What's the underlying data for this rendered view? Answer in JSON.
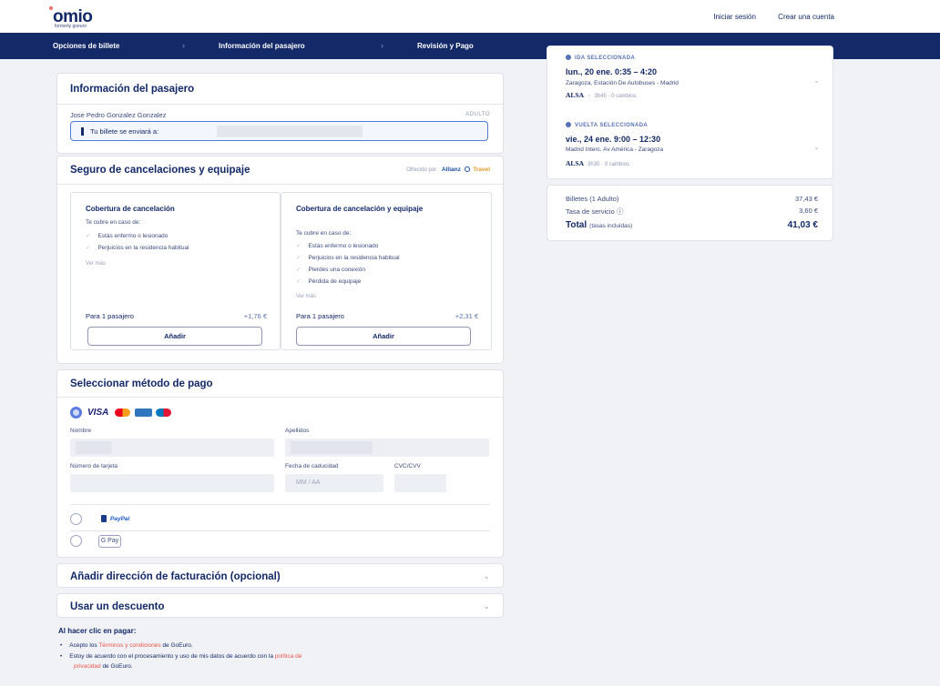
{
  "brand": {
    "logo": "omio",
    "tagline": "formerly goeuro"
  },
  "header": {
    "login": "Iniciar sesión",
    "signup": "Crear una cuenta"
  },
  "steps": [
    {
      "label": "Opciones de billete"
    },
    {
      "label": "Información del pasajero"
    },
    {
      "label": "Revisión y Pago"
    }
  ],
  "passenger": {
    "title": "Información del pasajero",
    "name": "Jose Pedro Gonzalez Gonzalez",
    "type": "ADULTO",
    "ticket_label": "Tu billete se enviará a:"
  },
  "insurance": {
    "title": "Seguro de cancelaciones y equipaje",
    "offered_by": "Ofrecido por",
    "partner": "Allianz",
    "partner_suffix": "Travel",
    "options": [
      {
        "title": "Cobertura de cancelación",
        "covers": "Te cubre en caso de:",
        "items": [
          "Estás enfermo o lesionado",
          "Perjuicios en la residencia habitual"
        ],
        "more": "Ver más",
        "for": "Para 1 pasajero",
        "price": "+1,76 €",
        "button": "Añadir"
      },
      {
        "title": "Cobertura de cancelación y equipaje",
        "covers": "Te cubre en caso de:",
        "items": [
          "Estás enfermo o lesionado",
          "Perjuicios en la residencia habitual",
          "Pierdes una conexión",
          "Pérdida de equipaje"
        ],
        "more": "Ver más",
        "for": "Para 1 pasajero",
        "price": "+2,31 €",
        "button": "Añadir"
      }
    ]
  },
  "payment": {
    "title": "Seleccionar método de pago",
    "card_brand": "VISA",
    "first_name_label": "Nombre",
    "last_name_label": "Apellidos",
    "card_number_label": "Número de tarjeta",
    "expiry_label": "Fecha de caducidad",
    "expiry_placeholder": "MM / AA",
    "cvc_label": "CVC/CVV",
    "paypal": "PayPal",
    "gpay": "G Pay"
  },
  "billing": {
    "title": "Añadir dirección de facturación (opcional)"
  },
  "discount": {
    "title": "Usar un descuento"
  },
  "terms": {
    "title": "Al hacer clic en pagar:",
    "line1_pre": "Acepto los ",
    "line1_link": "Términos y condiciones",
    "line1_post": " de GoEuro.",
    "line2_pre": "Estoy de acuerdo con el procesamiento y uso de mis datos de acuerdo con la ",
    "line2_link": "política de",
    "line3_link": "privacidad",
    "line3_post": " de GoEuro."
  },
  "trips": [
    {
      "heading": "IDA SELECCIONADA",
      "time": "lun., 20 ene.  0:35 – 4:20",
      "route": "Zaragoza, Estación De Autobuses  -  Madrid",
      "operator": "ALSA",
      "duration": "3h45 · 0 cambios"
    },
    {
      "heading": "VUELTA SELECCIONADA",
      "time": "vie., 24 ene.  9:00 – 12:30",
      "route": "Madrid Interc. Av América  -  Zaragoza",
      "operator": "ALSA",
      "duration": "3h30 · 0 cambios"
    }
  ],
  "summary": {
    "tickets_label": "Billetes  (1 Adulto)",
    "tickets_value": "37,43 €",
    "fee_label": "Tasa de servicio ⓘ",
    "fee_value": "3,60 €",
    "total_label": "Total",
    "total_note": "(tasas incluidas)",
    "total_value": "41,03 €"
  },
  "colors": {
    "navy": "#132968",
    "accent": "#5a7be0",
    "link_red": "#e8544a",
    "background": "#f1f2f6"
  }
}
